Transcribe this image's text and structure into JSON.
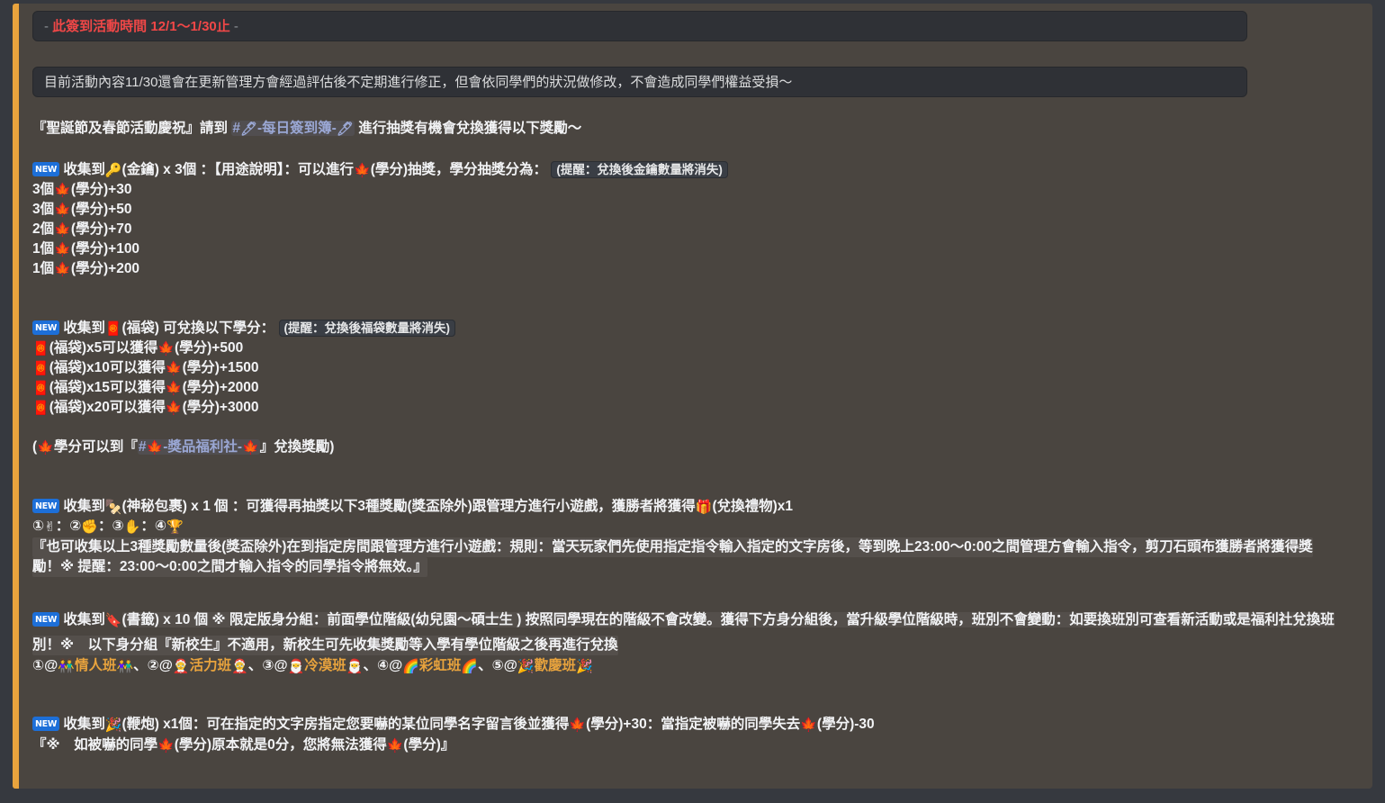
{
  "theme": {
    "page_bg": "#36393f",
    "embed_bg": "#4a4540",
    "accent_bar": "#e8a33d",
    "codeblock_bg": "#2f3136",
    "link_color": "#9aa7d4",
    "red": "#f04747",
    "gold": "#e8a33d",
    "badge_blue": "#1d6fd8",
    "text": "#f2f3f5"
  },
  "badges": {
    "new": "NEW"
  },
  "quote_blocks": {
    "event_period": {
      "dash_left": "-",
      "label": "此簽到活動時間",
      "dates": "12/1～1/30止",
      "dash_right": "-"
    },
    "notice": "目前活動內容11/30還會在更新管理方會經過評估後不定期進行修正，但會依同學們的狀況做修改，不會造成同學們權益受損～"
  },
  "intro": {
    "prefix": "『聖誕節及春節活動慶祝』請到",
    "link": "#🖊-每日簽到簿-🖊",
    "link_hash": "#",
    "link_emoji": "🖊",
    "link_text": "-每日簽到簿-",
    "suffix": "進行抽獎有機會兌換獲得以下獎勵～"
  },
  "sections": {
    "gold_key": {
      "header_a": "收集到",
      "emoji": "🔑",
      "header_b": "(金鑰) x 3個 ：【用途說明】：可以進行",
      "emoji2": "🍁",
      "header_c": "(學分)抽獎，學分抽獎分為：",
      "note": "(提醒：兌換後金鑰數量將消失)",
      "rewards": [
        {
          "qty": "3個",
          "emoji": "🍁",
          "label": "(學分)",
          "amount": "+30"
        },
        {
          "qty": "3個",
          "emoji": "🍁",
          "label": "(學分)",
          "amount": "+50"
        },
        {
          "qty": "2個",
          "emoji": "🍁",
          "label": "(學分)",
          "amount": "+70"
        },
        {
          "qty": "1個",
          "emoji": "🍁",
          "label": "(學分)",
          "amount": "+100"
        },
        {
          "qty": "1個",
          "emoji": "🍁",
          "label": "(學分)",
          "amount": "+200"
        }
      ]
    },
    "lucky_bag": {
      "header_a": "收集到",
      "emoji": "🧧",
      "header_b": "(福袋) 可兌換以下學分：",
      "note": "(提醒：兌換後福袋數量將消失)",
      "rewards": [
        {
          "emoji": "🧧",
          "label": "(福袋)",
          "qty": "x5",
          "mid": "可以獲得",
          "emoji2": "🍁",
          "unit": "(學分)",
          "amount": "+500"
        },
        {
          "emoji": "🧧",
          "label": "(福袋)",
          "qty": "x10",
          "mid": "可以獲得",
          "emoji2": "🍁",
          "unit": "(學分)",
          "amount": "+1500"
        },
        {
          "emoji": "🧧",
          "label": "(福袋)",
          "qty": "x15",
          "mid": "可以獲得",
          "emoji2": "🍁",
          "unit": "(學分)",
          "amount": "+2000"
        },
        {
          "emoji": "🧧",
          "label": "(福袋)",
          "qty": "x20",
          "mid": "可以獲得",
          "emoji2": "🍁",
          "unit": "(學分)",
          "amount": "+3000"
        }
      ],
      "footer_prefix": "(",
      "footer_emoji": "🍁",
      "footer_a": "學分可以到『",
      "footer_link": "#🍁-獎品福利社-🍁",
      "footer_link_hash": "#",
      "footer_link_emoji": "🍁",
      "footer_link_text": "-獎品福利社-",
      "footer_b": "』兌換獎勵)"
    },
    "mystery_parcel": {
      "header_a": "收集到",
      "emoji": "🍢",
      "header_b": "(神秘包裹) x 1 個 ：可獲得再抽獎以下3種獎勵(獎盃除外)跟管理方進行小遊戲，獲勝者將獲得",
      "emoji2": "🎁",
      "header_c": "(兌換禮物)x1",
      "choices": [
        {
          "num": "①",
          "emoji": "✌"
        },
        {
          "num": "②",
          "emoji": "✊"
        },
        {
          "num": "③",
          "emoji": "✋"
        },
        {
          "num": "④",
          "emoji": "🏆"
        }
      ],
      "rule_line1": "『也可收集以上3種獎勵數量後(獎盃除外)在到指定房間跟管理方進行小遊戲：規則：當天玩家們先使用指定指令輸入指定的文字房後，等到晚上23:00～0:00之間管理方會輸入指令，剪刀石頭布獲勝者將獲得獎",
      "rule_line2": "勵！※ 提醒：23:00～0:00之間才輸入指令的同學指令將無效。』"
    },
    "bookmark": {
      "header_a": "收集到",
      "emoji": "🔖",
      "header_b": "(書籤) x 10 個 ※ 限定版身分組：前面學位階級(幼兒園～碩士生 ) 按照同學現在的階級不會改變。獲得下方身分組後，當升級學位階級時，班別不會變動：如要換班別可查看新活動或是福利社兌換班",
      "header_c": "別！※　以下身分組『新校生』不適用，新校生可先收集獎勵等入學有學位階級之後再進行兌換",
      "groups": [
        {
          "num": "①",
          "at": "@",
          "emoji_l": "👫",
          "name": "情人班",
          "emoji_r": "👫",
          "sep": "、"
        },
        {
          "num": "②",
          "at": "@",
          "emoji_l": "🤶",
          "name": "活力班",
          "emoji_r": "🤶",
          "sep": "、"
        },
        {
          "num": "③",
          "at": "@",
          "emoji_l": "🎅",
          "name": "冷漠班",
          "emoji_r": "🎅",
          "sep": "、"
        },
        {
          "num": "④",
          "at": "@",
          "emoji_l": "🌈",
          "name": "彩虹班",
          "emoji_r": "🌈",
          "sep": "、"
        },
        {
          "num": "⑤",
          "at": "@",
          "emoji_l": "🎉",
          "name": "歡慶班",
          "emoji_r": "🎉",
          "sep": ""
        }
      ]
    },
    "firecracker": {
      "header_a": "收集到",
      "emoji": "🎉",
      "header_b": "(鞭炮) x1個：可在指定的文字房指定您要嚇的某位同學名字留言後並獲得",
      "emoji2": "🍁",
      "header_c": "(學分)+30：當指定被嚇的同學失去",
      "emoji3": "🍁",
      "header_d": "(學分)-30",
      "note_line": "『※　如被嚇的同學",
      "note_emoji": "🍁",
      "note_mid": "(學分)原本就是0分，您將無法獲得",
      "note_emoji2": "🍁",
      "note_end": "(學分)』"
    }
  }
}
